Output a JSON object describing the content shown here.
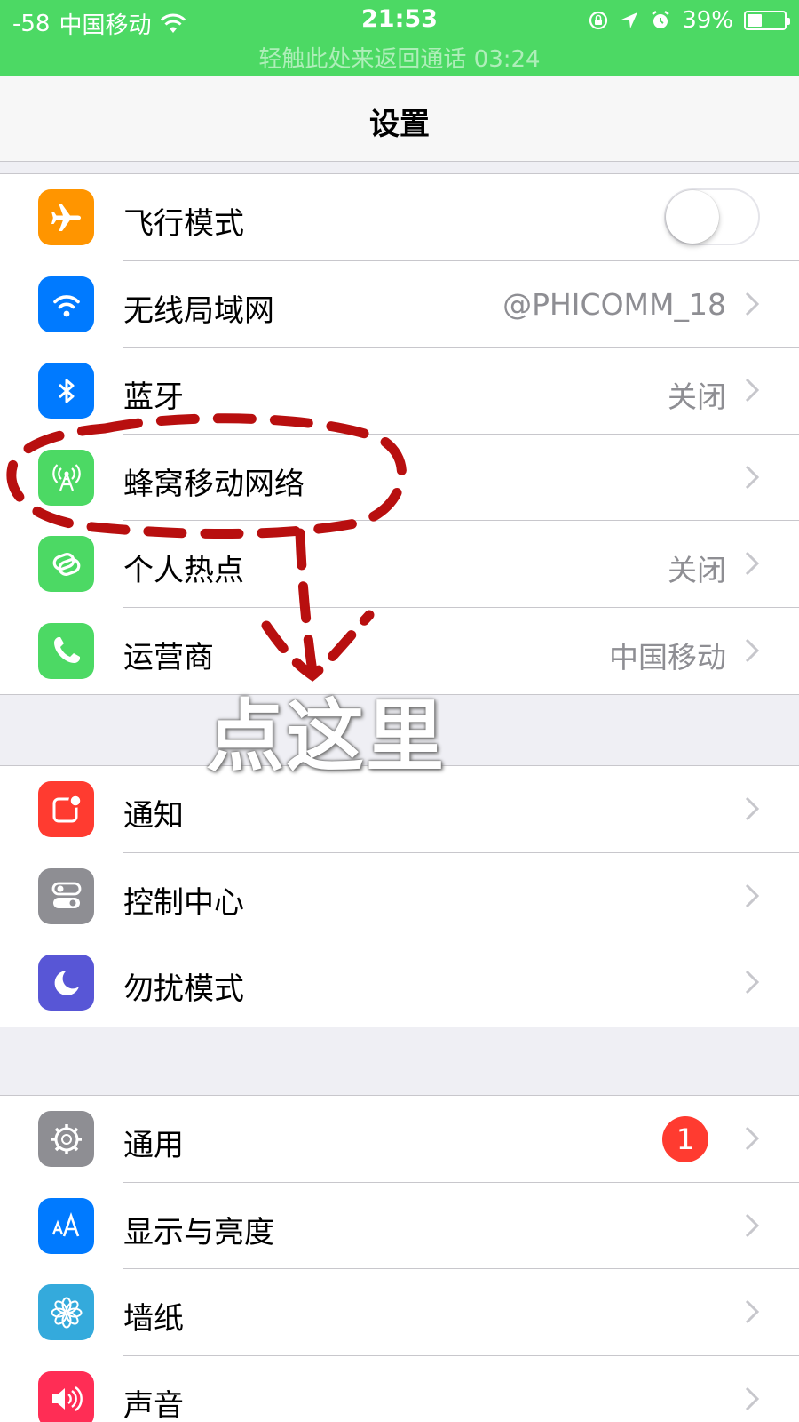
{
  "status_bar": {
    "signal": "-58",
    "carrier": "中国移动",
    "time": "21:53",
    "battery_percent": "39%",
    "battery_level": 0.39,
    "call_banner": "轻触此处来返回通话 03:24",
    "background_color": "#4cd964"
  },
  "nav": {
    "title": "设置"
  },
  "groups": [
    {
      "rows": [
        {
          "label": "飞行模式",
          "icon": "airplane-icon",
          "icon_color": "#ff9500",
          "control": "toggle",
          "toggle_on": false
        },
        {
          "label": "无线局域网",
          "icon": "wifi-icon",
          "icon_color": "#007aff",
          "value": "@PHICOMM_18"
        },
        {
          "label": "蓝牙",
          "icon": "bluetooth-icon",
          "icon_color": "#007aff",
          "value": "关闭"
        },
        {
          "label": "蜂窝移动网络",
          "icon": "cellular-antenna-icon",
          "icon_color": "#4cd964"
        },
        {
          "label": "个人热点",
          "icon": "hotspot-link-icon",
          "icon_color": "#4cd964",
          "value": "关闭"
        },
        {
          "label": "运营商",
          "icon": "phone-icon",
          "icon_color": "#4cd964",
          "value": "中国移动"
        }
      ]
    },
    {
      "rows": [
        {
          "label": "通知",
          "icon": "notification-icon",
          "icon_color": "#ff3b30"
        },
        {
          "label": "控制中心",
          "icon": "control-center-icon",
          "icon_color": "#8e8e93"
        },
        {
          "label": "勿扰模式",
          "icon": "moon-icon",
          "icon_color": "#5856d6"
        }
      ]
    },
    {
      "rows": [
        {
          "label": "通用",
          "icon": "gear-icon",
          "icon_color": "#8e8e93",
          "badge": "1"
        },
        {
          "label": "显示与亮度",
          "icon": "text-size-icon",
          "icon_color": "#007aff"
        },
        {
          "label": "墙纸",
          "icon": "flower-icon",
          "icon_color": "#34aadc"
        },
        {
          "label": "声音",
          "icon": "speaker-icon",
          "icon_color": "#ff2d55"
        }
      ]
    }
  ],
  "annotation": {
    "text": "点这里",
    "color": "#b80f0f"
  }
}
